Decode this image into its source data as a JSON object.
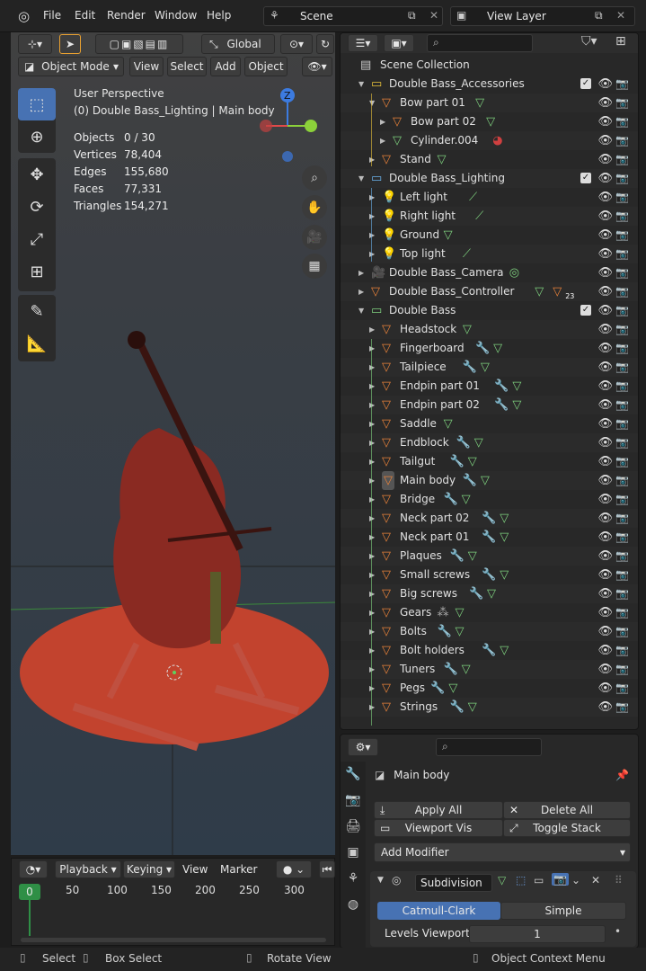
{
  "topbar": {
    "menus": [
      "File",
      "Edit",
      "Render",
      "Window",
      "Help"
    ],
    "scene_label": "Scene",
    "view_layer_label": "View Layer"
  },
  "viewport": {
    "transform_orientation": "Global",
    "mode": "Object Mode",
    "menus": [
      "View",
      "Select",
      "Add",
      "Object"
    ],
    "perspective": "User Perspective",
    "context": "(0) Double Bass_Lighting | Main body",
    "stats": [
      {
        "key": "Objects",
        "value": "0 / 30"
      },
      {
        "key": "Vertices",
        "value": "78,404"
      },
      {
        "key": "Edges",
        "value": "155,680"
      },
      {
        "key": "Faces",
        "value": "77,331"
      },
      {
        "key": "Triangles",
        "value": "154,271"
      }
    ],
    "gizmo_z": "Z"
  },
  "outliner": {
    "search_placeholder": "",
    "scene_collection": "Scene Collection",
    "rows": [
      {
        "label": "Double Bass_Accessories",
        "kind": "collection"
      },
      {
        "label": "Bow part 01",
        "kind": "object"
      },
      {
        "label": "Bow part 02",
        "kind": "object"
      },
      {
        "label": "Cylinder.004",
        "kind": "mesh"
      },
      {
        "label": "Stand",
        "kind": "object"
      },
      {
        "label": "Double Bass_Lighting",
        "kind": "collection"
      },
      {
        "label": "Left light",
        "kind": "light"
      },
      {
        "label": "Right light",
        "kind": "light"
      },
      {
        "label": "Ground",
        "kind": "light"
      },
      {
        "label": "Top light",
        "kind": "light"
      },
      {
        "label": "Double Bass_Camera",
        "kind": "object"
      },
      {
        "label": "Double Bass_Controller",
        "kind": "object"
      },
      {
        "label": "Double Bass",
        "kind": "collection"
      },
      {
        "label": "Headstock",
        "kind": "object"
      },
      {
        "label": "Fingerboard",
        "kind": "object"
      },
      {
        "label": "Tailpiece",
        "kind": "object"
      },
      {
        "label": "Endpin part 01",
        "kind": "object"
      },
      {
        "label": "Endpin part 02",
        "kind": "object"
      },
      {
        "label": "Saddle",
        "kind": "object"
      },
      {
        "label": "Endblock",
        "kind": "object"
      },
      {
        "label": "Tailgut",
        "kind": "object"
      },
      {
        "label": "Main body",
        "kind": "object"
      },
      {
        "label": "Bridge",
        "kind": "object"
      },
      {
        "label": "Neck part 02",
        "kind": "object"
      },
      {
        "label": "Neck part 01",
        "kind": "object"
      },
      {
        "label": "Plaques",
        "kind": "object"
      },
      {
        "label": "Small screws",
        "kind": "object"
      },
      {
        "label": "Big screws",
        "kind": "object"
      },
      {
        "label": "Gears",
        "kind": "object"
      },
      {
        "label": "Bolts",
        "kind": "object"
      },
      {
        "label": "Bolt holders",
        "kind": "object"
      },
      {
        "label": "Tuners",
        "kind": "object"
      },
      {
        "label": "Pegs",
        "kind": "object"
      },
      {
        "label": "Strings",
        "kind": "object"
      }
    ],
    "controller_badge": "23"
  },
  "properties": {
    "object_name": "Main body",
    "apply_all": "Apply All",
    "delete_all": "Delete All",
    "viewport_vis": "Viewport Vis",
    "toggle_stack": "Toggle Stack",
    "add_modifier": "Add Modifier",
    "modifier_name": "Subdivision",
    "catmull": "Catmull-Clark",
    "simple": "Simple",
    "levels_label": "Levels Viewport",
    "levels_value": "1"
  },
  "timeline": {
    "menus": [
      "Playback",
      "Keying",
      "View",
      "Marker"
    ],
    "current_frame": "0",
    "ticks": [
      "50",
      "100",
      "150",
      "200",
      "250",
      "300"
    ]
  },
  "statusbar": {
    "select": "Select",
    "box_select": "Box Select",
    "rotate_view": "Rotate View",
    "context_menu": "Object Context Menu"
  },
  "colors": {
    "accent_blue": "#4772b3",
    "object_orange": "#e8823a",
    "modifier_blue": "#6a9bdc",
    "mesh_green": "#7ed07e"
  }
}
